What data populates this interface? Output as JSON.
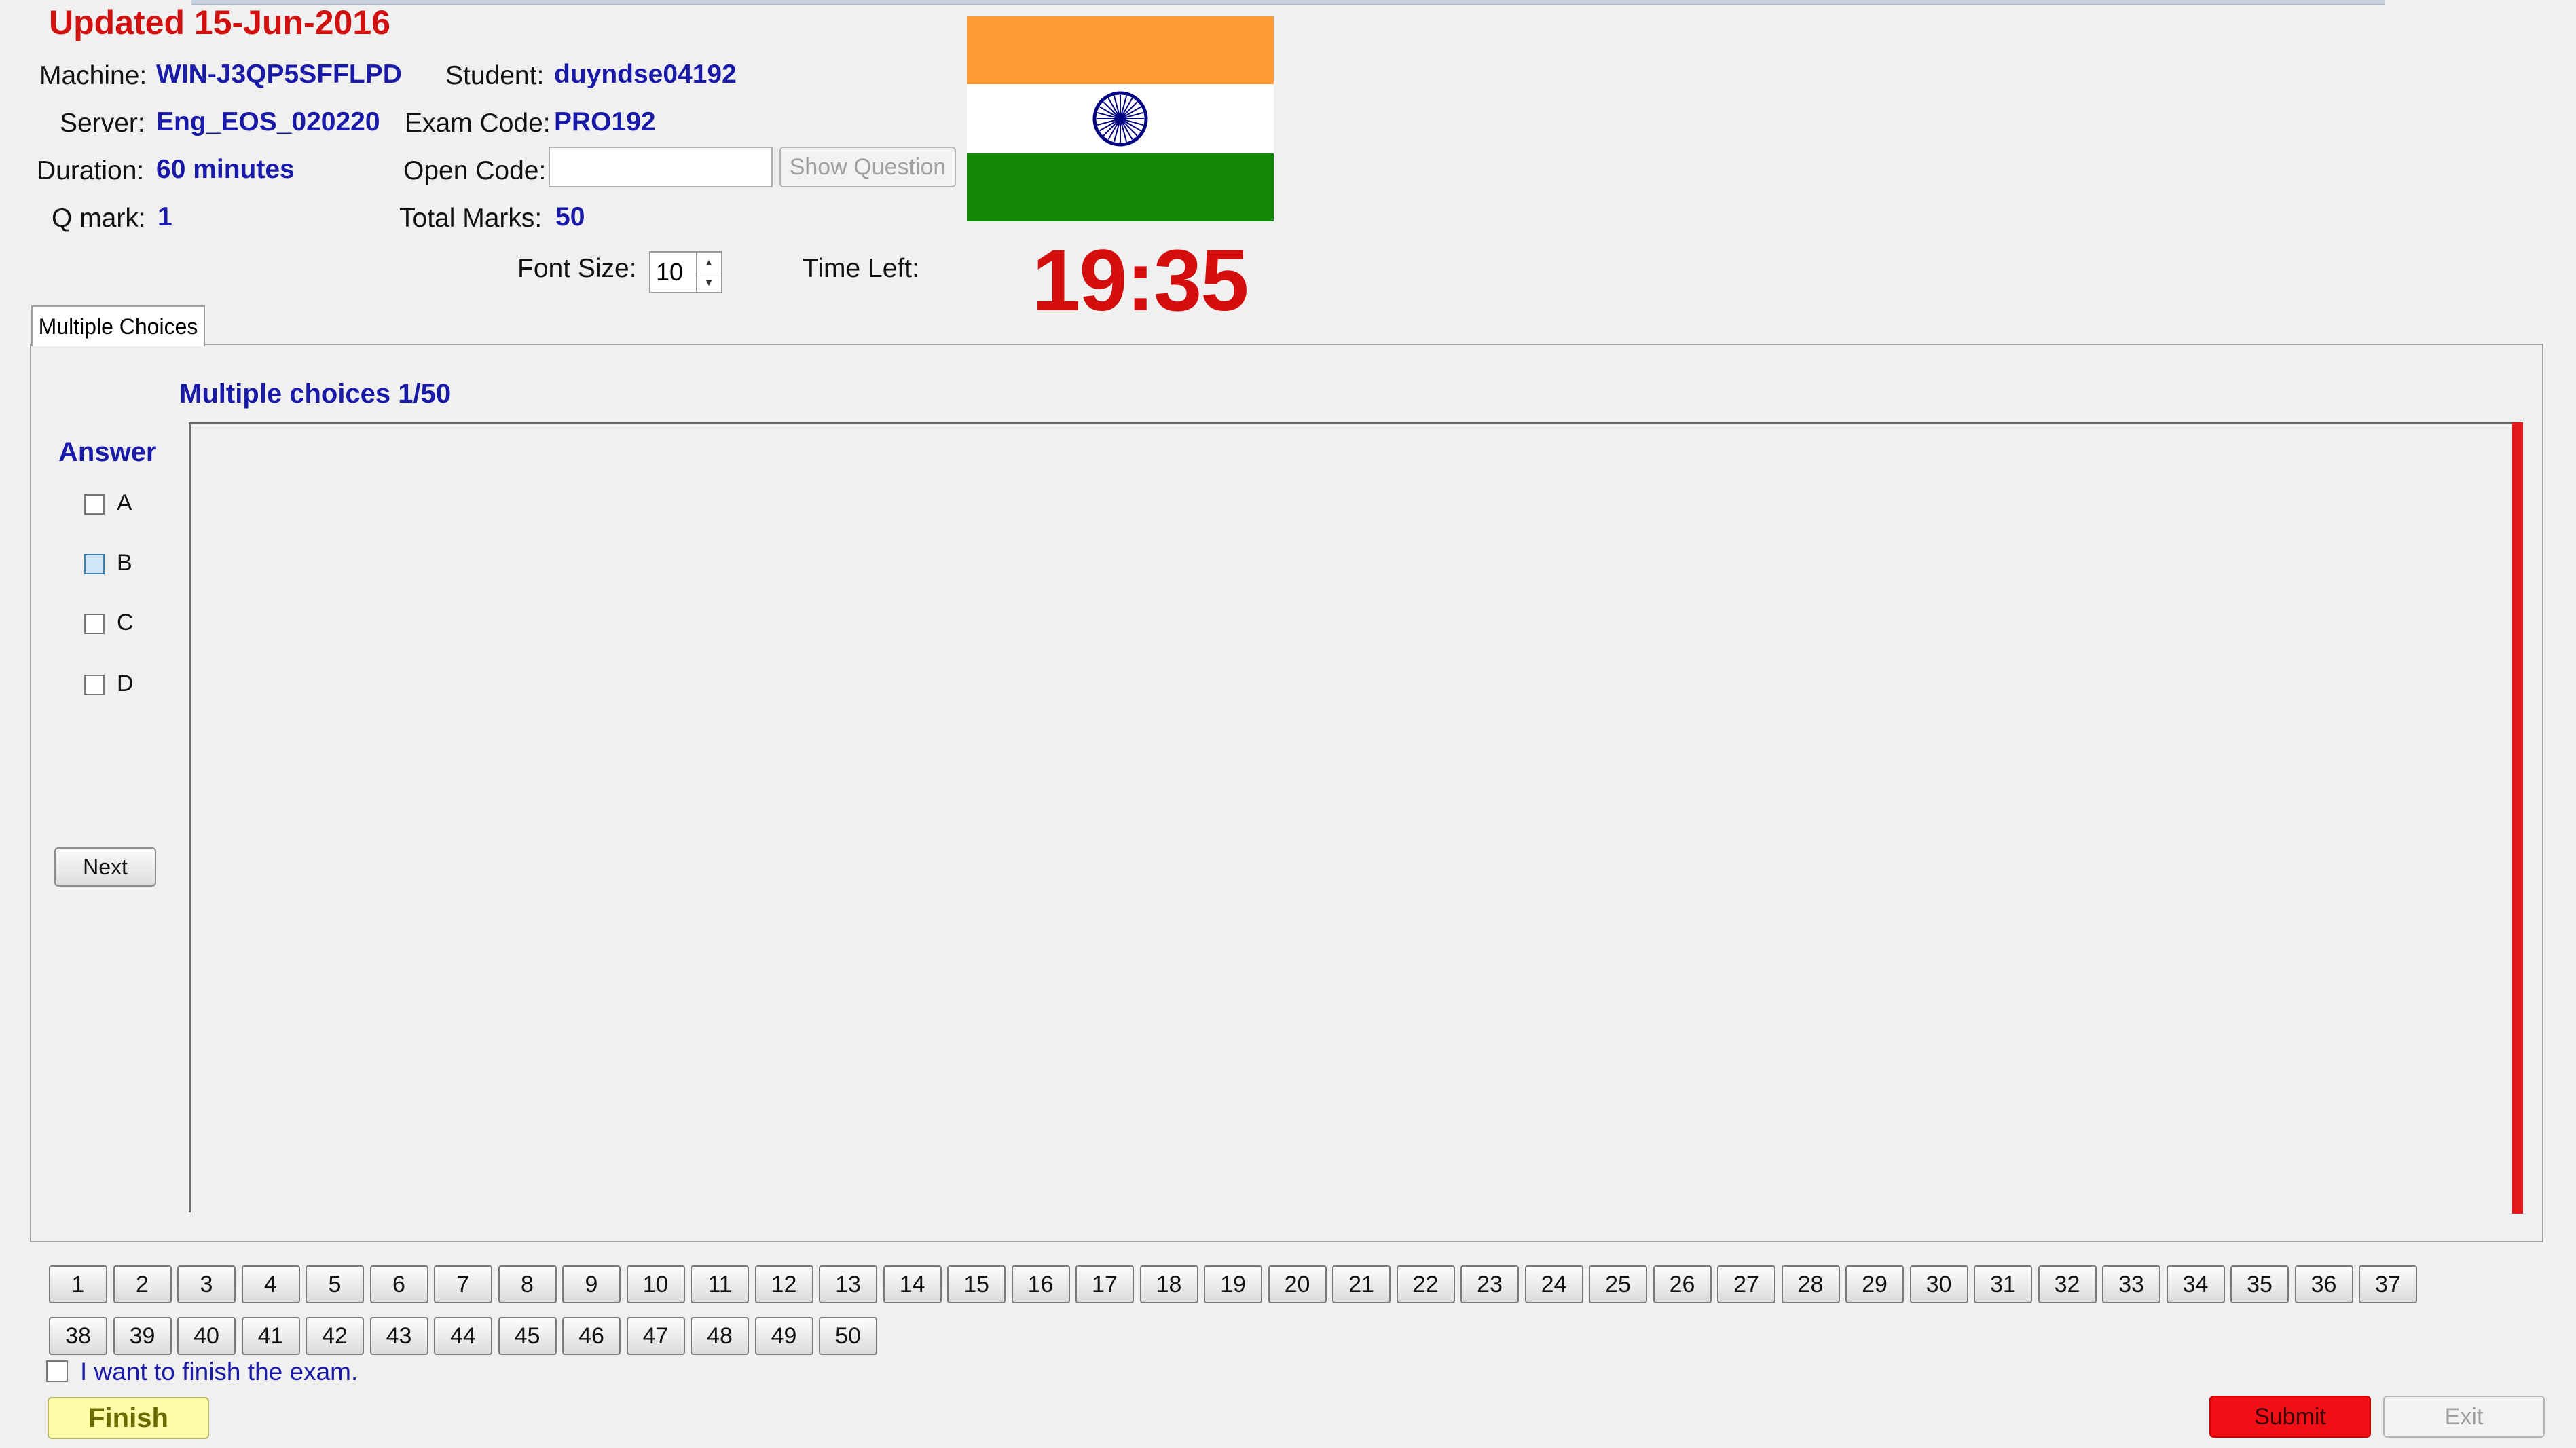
{
  "header": {
    "updated": "Updated 15-Jun-2016",
    "machine_label": "Machine:",
    "machine_value": "WIN-J3QP5SFFLPD",
    "student_label": "Student:",
    "student_value": "duyndse04192",
    "server_label": "Server:",
    "server_value": "Eng_EOS_020220",
    "exam_code_label": "Exam Code:",
    "exam_code_value": "PRO192",
    "duration_label": "Duration:",
    "duration_value": "60 minutes",
    "open_code_label": "Open Code:",
    "open_code_value": "",
    "show_question_label": "Show Question",
    "qmark_label": "Q mark:",
    "qmark_value": "1",
    "total_marks_label": "Total Marks:",
    "total_marks_value": "50",
    "font_size_label": "Font Size:",
    "font_size_value": "10",
    "time_left_label": "Time Left:",
    "time_left_value": "19:35"
  },
  "flag": {
    "top_color": "#ff9933",
    "middle_color": "#ffffff",
    "bottom_color": "#138808",
    "wheel_color": "#000080"
  },
  "tab": {
    "label": "Multiple Choices"
  },
  "question": {
    "title": "Multiple choices 1/50",
    "answer_label": "Answer",
    "options": [
      "A",
      "B",
      "C",
      "D"
    ],
    "highlighted_option": "B",
    "next_label": "Next"
  },
  "question_nav": {
    "row1": [
      "1",
      "2",
      "3",
      "4",
      "5",
      "6",
      "7",
      "8",
      "9",
      "10",
      "11",
      "12",
      "13",
      "14",
      "15",
      "16",
      "17",
      "18",
      "19",
      "20",
      "21",
      "22",
      "23",
      "24",
      "25",
      "26",
      "27",
      "28",
      "29",
      "30",
      "31",
      "32",
      "33",
      "34",
      "35",
      "36",
      "37"
    ],
    "row2": [
      "38",
      "39",
      "40",
      "41",
      "42",
      "43",
      "44",
      "45",
      "46",
      "47",
      "48",
      "49",
      "50"
    ]
  },
  "footer": {
    "finish_checkbox_label": "I want to finish the exam.",
    "finish_label": "Finish",
    "submit_label": "Submit",
    "exit_label": "Exit",
    "submit_color": "#ef0f14",
    "finish_color": "#fdfda8"
  }
}
